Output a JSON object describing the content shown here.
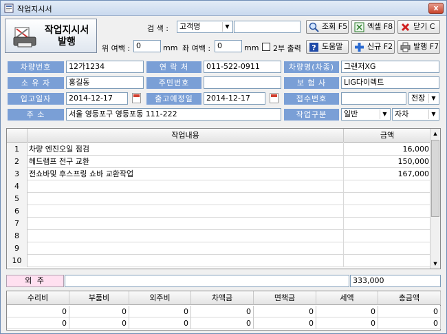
{
  "window": {
    "title": "작업지시서",
    "close_label": "x"
  },
  "issue_button": {
    "label_line1": "작업지시서",
    "label_line2": "발행"
  },
  "search": {
    "label": "검  색 :",
    "type_value": "고객명",
    "query_value": ""
  },
  "buttons": {
    "lookup": "조회 F5",
    "excel": "엑셀 F8",
    "close": "닫기 C",
    "help": "도움말",
    "new": "신규 F2",
    "print": "발행 F7"
  },
  "margins": {
    "top_label": "위 여백 :",
    "top_value": "0",
    "top_unit": "mm",
    "left_label": "좌 여백 :",
    "left_value": "0",
    "left_unit": "mm",
    "two_copies_label": "2부 출력"
  },
  "form": {
    "car_number_label": "차량번호",
    "car_number": "12가1234",
    "contact_label": "연 락 처",
    "contact": "011-522-0911",
    "car_model_label": "차량명(차종)",
    "car_model": "그랜저XG",
    "owner_label": "소 유 자",
    "owner": "홍길동",
    "resident_no_label": "주민번호",
    "resident_no": "",
    "insurer_label": "보 험 사",
    "insurer": "LIG다이렉트",
    "in_date_label": "입고일자",
    "in_date": "2014-12-17",
    "out_date_label": "출고예정일",
    "out_date": "2014-12-17",
    "receipt_label": "접수번호",
    "receipt_no": "",
    "receipt_type": "전장",
    "address_label": "주    소",
    "address": "서울 영등포구 영등포동 111-222",
    "work_type_label": "작업구분",
    "work_type": "일반",
    "work_kind": "자차"
  },
  "grid": {
    "col_desc": "작업내용",
    "col_amount": "금액",
    "rows": [
      {
        "n": "1",
        "desc": "차량 엔진오일 점검",
        "amount": "16,000"
      },
      {
        "n": "2",
        "desc": "헤드램프 전구 교환",
        "amount": "150,000"
      },
      {
        "n": "3",
        "desc": "전쇼바및 후스프링 쇼바 교환작업",
        "amount": "167,000"
      },
      {
        "n": "4",
        "desc": "",
        "amount": ""
      },
      {
        "n": "5",
        "desc": "",
        "amount": ""
      },
      {
        "n": "6",
        "desc": "",
        "amount": ""
      },
      {
        "n": "7",
        "desc": "",
        "amount": ""
      },
      {
        "n": "8",
        "desc": "",
        "amount": ""
      },
      {
        "n": "9",
        "desc": "",
        "amount": ""
      },
      {
        "n": "10",
        "desc": "",
        "amount": ""
      }
    ]
  },
  "outsource": {
    "label": "외    주",
    "desc": "",
    "total": "333,000"
  },
  "summary": {
    "headers": [
      "수리비",
      "부품비",
      "외주비",
      "차액금",
      "면책금",
      "세액",
      "총금액"
    ],
    "row1": [
      "0",
      "0",
      "0",
      "0",
      "0",
      "0",
      "0"
    ],
    "row2": [
      "0",
      "0",
      "0",
      "0",
      "0",
      "0",
      "0"
    ]
  }
}
